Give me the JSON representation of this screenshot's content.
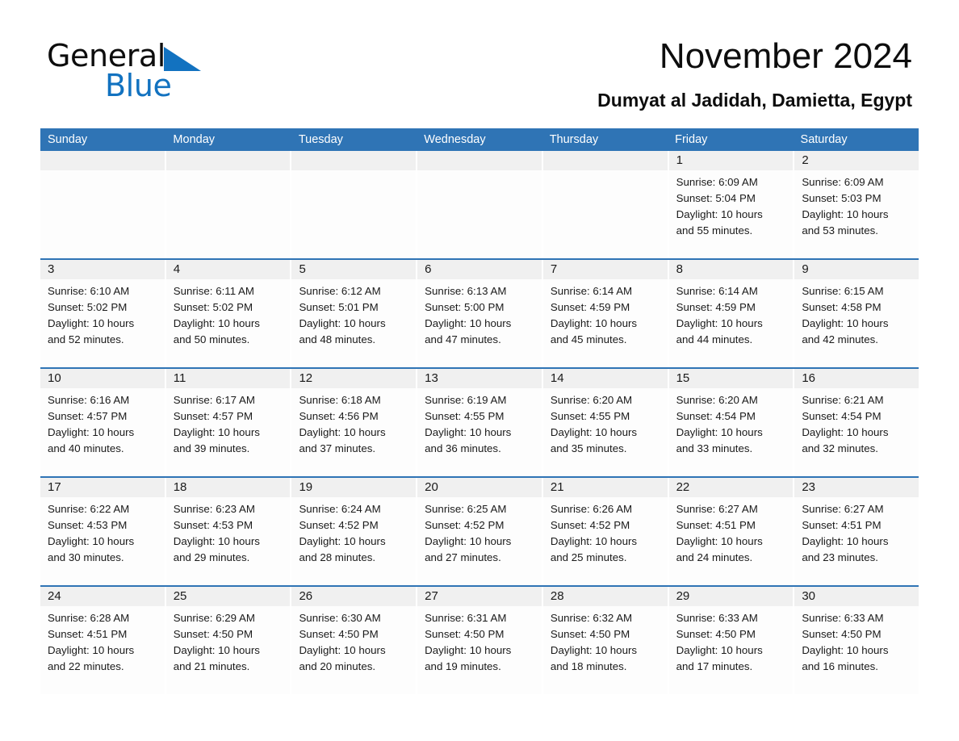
{
  "logo": {
    "word1": "General",
    "word2": "Blue",
    "triangle_icon": "triangle-icon",
    "blue_hex": "#1272c0"
  },
  "header": {
    "title": "November 2024",
    "subtitle": "Dumyat al Jadidah, Damietta, Egypt"
  },
  "theme": {
    "header_row_bg": "#2f74b5",
    "day_number_bg": "#f0f0f0",
    "cell_bg": "#fdfdfd",
    "text": "#1a1a1a"
  },
  "weekdays": [
    "Sunday",
    "Monday",
    "Tuesday",
    "Wednesday",
    "Thursday",
    "Friday",
    "Saturday"
  ],
  "weeks": [
    [
      {
        "day": "",
        "sunrise": "",
        "sunset": "",
        "daylight1": "",
        "daylight2": ""
      },
      {
        "day": "",
        "sunrise": "",
        "sunset": "",
        "daylight1": "",
        "daylight2": ""
      },
      {
        "day": "",
        "sunrise": "",
        "sunset": "",
        "daylight1": "",
        "daylight2": ""
      },
      {
        "day": "",
        "sunrise": "",
        "sunset": "",
        "daylight1": "",
        "daylight2": ""
      },
      {
        "day": "",
        "sunrise": "",
        "sunset": "",
        "daylight1": "",
        "daylight2": ""
      },
      {
        "day": "1",
        "sunrise": "Sunrise: 6:09 AM",
        "sunset": "Sunset: 5:04 PM",
        "daylight1": "Daylight: 10 hours",
        "daylight2": "and 55 minutes."
      },
      {
        "day": "2",
        "sunrise": "Sunrise: 6:09 AM",
        "sunset": "Sunset: 5:03 PM",
        "daylight1": "Daylight: 10 hours",
        "daylight2": "and 53 minutes."
      }
    ],
    [
      {
        "day": "3",
        "sunrise": "Sunrise: 6:10 AM",
        "sunset": "Sunset: 5:02 PM",
        "daylight1": "Daylight: 10 hours",
        "daylight2": "and 52 minutes."
      },
      {
        "day": "4",
        "sunrise": "Sunrise: 6:11 AM",
        "sunset": "Sunset: 5:02 PM",
        "daylight1": "Daylight: 10 hours",
        "daylight2": "and 50 minutes."
      },
      {
        "day": "5",
        "sunrise": "Sunrise: 6:12 AM",
        "sunset": "Sunset: 5:01 PM",
        "daylight1": "Daylight: 10 hours",
        "daylight2": "and 48 minutes."
      },
      {
        "day": "6",
        "sunrise": "Sunrise: 6:13 AM",
        "sunset": "Sunset: 5:00 PM",
        "daylight1": "Daylight: 10 hours",
        "daylight2": "and 47 minutes."
      },
      {
        "day": "7",
        "sunrise": "Sunrise: 6:14 AM",
        "sunset": "Sunset: 4:59 PM",
        "daylight1": "Daylight: 10 hours",
        "daylight2": "and 45 minutes."
      },
      {
        "day": "8",
        "sunrise": "Sunrise: 6:14 AM",
        "sunset": "Sunset: 4:59 PM",
        "daylight1": "Daylight: 10 hours",
        "daylight2": "and 44 minutes."
      },
      {
        "day": "9",
        "sunrise": "Sunrise: 6:15 AM",
        "sunset": "Sunset: 4:58 PM",
        "daylight1": "Daylight: 10 hours",
        "daylight2": "and 42 minutes."
      }
    ],
    [
      {
        "day": "10",
        "sunrise": "Sunrise: 6:16 AM",
        "sunset": "Sunset: 4:57 PM",
        "daylight1": "Daylight: 10 hours",
        "daylight2": "and 40 minutes."
      },
      {
        "day": "11",
        "sunrise": "Sunrise: 6:17 AM",
        "sunset": "Sunset: 4:57 PM",
        "daylight1": "Daylight: 10 hours",
        "daylight2": "and 39 minutes."
      },
      {
        "day": "12",
        "sunrise": "Sunrise: 6:18 AM",
        "sunset": "Sunset: 4:56 PM",
        "daylight1": "Daylight: 10 hours",
        "daylight2": "and 37 minutes."
      },
      {
        "day": "13",
        "sunrise": "Sunrise: 6:19 AM",
        "sunset": "Sunset: 4:55 PM",
        "daylight1": "Daylight: 10 hours",
        "daylight2": "and 36 minutes."
      },
      {
        "day": "14",
        "sunrise": "Sunrise: 6:20 AM",
        "sunset": "Sunset: 4:55 PM",
        "daylight1": "Daylight: 10 hours",
        "daylight2": "and 35 minutes."
      },
      {
        "day": "15",
        "sunrise": "Sunrise: 6:20 AM",
        "sunset": "Sunset: 4:54 PM",
        "daylight1": "Daylight: 10 hours",
        "daylight2": "and 33 minutes."
      },
      {
        "day": "16",
        "sunrise": "Sunrise: 6:21 AM",
        "sunset": "Sunset: 4:54 PM",
        "daylight1": "Daylight: 10 hours",
        "daylight2": "and 32 minutes."
      }
    ],
    [
      {
        "day": "17",
        "sunrise": "Sunrise: 6:22 AM",
        "sunset": "Sunset: 4:53 PM",
        "daylight1": "Daylight: 10 hours",
        "daylight2": "and 30 minutes."
      },
      {
        "day": "18",
        "sunrise": "Sunrise: 6:23 AM",
        "sunset": "Sunset: 4:53 PM",
        "daylight1": "Daylight: 10 hours",
        "daylight2": "and 29 minutes."
      },
      {
        "day": "19",
        "sunrise": "Sunrise: 6:24 AM",
        "sunset": "Sunset: 4:52 PM",
        "daylight1": "Daylight: 10 hours",
        "daylight2": "and 28 minutes."
      },
      {
        "day": "20",
        "sunrise": "Sunrise: 6:25 AM",
        "sunset": "Sunset: 4:52 PM",
        "daylight1": "Daylight: 10 hours",
        "daylight2": "and 27 minutes."
      },
      {
        "day": "21",
        "sunrise": "Sunrise: 6:26 AM",
        "sunset": "Sunset: 4:52 PM",
        "daylight1": "Daylight: 10 hours",
        "daylight2": "and 25 minutes."
      },
      {
        "day": "22",
        "sunrise": "Sunrise: 6:27 AM",
        "sunset": "Sunset: 4:51 PM",
        "daylight1": "Daylight: 10 hours",
        "daylight2": "and 24 minutes."
      },
      {
        "day": "23",
        "sunrise": "Sunrise: 6:27 AM",
        "sunset": "Sunset: 4:51 PM",
        "daylight1": "Daylight: 10 hours",
        "daylight2": "and 23 minutes."
      }
    ],
    [
      {
        "day": "24",
        "sunrise": "Sunrise: 6:28 AM",
        "sunset": "Sunset: 4:51 PM",
        "daylight1": "Daylight: 10 hours",
        "daylight2": "and 22 minutes."
      },
      {
        "day": "25",
        "sunrise": "Sunrise: 6:29 AM",
        "sunset": "Sunset: 4:50 PM",
        "daylight1": "Daylight: 10 hours",
        "daylight2": "and 21 minutes."
      },
      {
        "day": "26",
        "sunrise": "Sunrise: 6:30 AM",
        "sunset": "Sunset: 4:50 PM",
        "daylight1": "Daylight: 10 hours",
        "daylight2": "and 20 minutes."
      },
      {
        "day": "27",
        "sunrise": "Sunrise: 6:31 AM",
        "sunset": "Sunset: 4:50 PM",
        "daylight1": "Daylight: 10 hours",
        "daylight2": "and 19 minutes."
      },
      {
        "day": "28",
        "sunrise": "Sunrise: 6:32 AM",
        "sunset": "Sunset: 4:50 PM",
        "daylight1": "Daylight: 10 hours",
        "daylight2": "and 18 minutes."
      },
      {
        "day": "29",
        "sunrise": "Sunrise: 6:33 AM",
        "sunset": "Sunset: 4:50 PM",
        "daylight1": "Daylight: 10 hours",
        "daylight2": "and 17 minutes."
      },
      {
        "day": "30",
        "sunrise": "Sunrise: 6:33 AM",
        "sunset": "Sunset: 4:50 PM",
        "daylight1": "Daylight: 10 hours",
        "daylight2": "and 16 minutes."
      }
    ]
  ]
}
